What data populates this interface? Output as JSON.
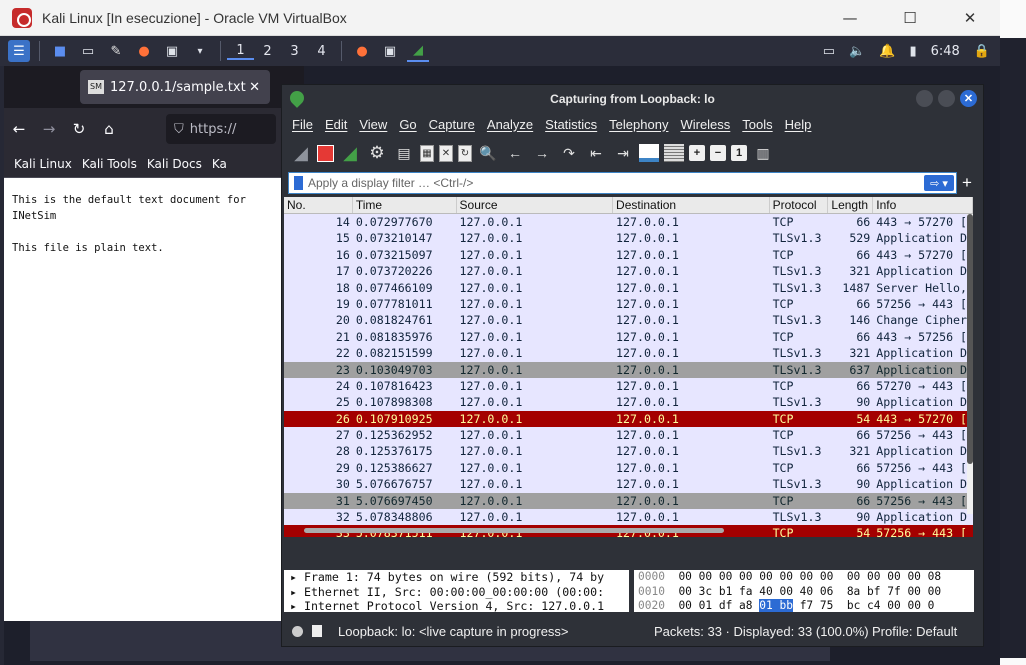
{
  "vbox": {
    "title": "Kali Linux [In esecuzione] - Oracle VM VirtualBox",
    "min": "—",
    "max": "☐",
    "close": "✕"
  },
  "panel": {
    "workspaces": [
      "1",
      "2",
      "3",
      "4"
    ],
    "clock": "6:48"
  },
  "firefox": {
    "tab_title": "127.0.0.1/sample.txt",
    "url": "https://",
    "bookmarks": [
      "Kali Linux",
      "Kali Tools",
      "Kali Docs",
      "Ka"
    ],
    "content_lines": [
      "This is the default text document for INetSim",
      "This file is plain text."
    ]
  },
  "wireshark": {
    "title": "Capturing from Loopback: lo",
    "menu": [
      "File",
      "Edit",
      "View",
      "Go",
      "Capture",
      "Analyze",
      "Statistics",
      "Telephony",
      "Wireless",
      "Tools",
      "Help"
    ],
    "filter_placeholder": "Apply a display filter … <Ctrl-/>",
    "columns": [
      "No.",
      "Time",
      "Source",
      "Destination",
      "Protocol",
      "Length",
      "Info"
    ],
    "packets": [
      {
        "no": "14",
        "time": "0.072977670",
        "src": "127.0.0.1",
        "dst": "127.0.0.1",
        "proto": "TCP",
        "len": "66",
        "info": "443 → 57270 [",
        "style": "tcp"
      },
      {
        "no": "15",
        "time": "0.073210147",
        "src": "127.0.0.1",
        "dst": "127.0.0.1",
        "proto": "TLSv1.3",
        "len": "529",
        "info": "Application D",
        "style": "tls"
      },
      {
        "no": "16",
        "time": "0.073215097",
        "src": "127.0.0.1",
        "dst": "127.0.0.1",
        "proto": "TCP",
        "len": "66",
        "info": "443 → 57270 [",
        "style": "tcp"
      },
      {
        "no": "17",
        "time": "0.073720226",
        "src": "127.0.0.1",
        "dst": "127.0.0.1",
        "proto": "TLSv1.3",
        "len": "321",
        "info": "Application D",
        "style": "tls"
      },
      {
        "no": "18",
        "time": "0.077466109",
        "src": "127.0.0.1",
        "dst": "127.0.0.1",
        "proto": "TLSv1.3",
        "len": "1487",
        "info": "Server Hello,",
        "style": "tls"
      },
      {
        "no": "19",
        "time": "0.077781011",
        "src": "127.0.0.1",
        "dst": "127.0.0.1",
        "proto": "TCP",
        "len": "66",
        "info": "57256 → 443 [",
        "style": "tcp"
      },
      {
        "no": "20",
        "time": "0.081824761",
        "src": "127.0.0.1",
        "dst": "127.0.0.1",
        "proto": "TLSv1.3",
        "len": "146",
        "info": "Change Cipher",
        "style": "tls"
      },
      {
        "no": "21",
        "time": "0.081835976",
        "src": "127.0.0.1",
        "dst": "127.0.0.1",
        "proto": "TCP",
        "len": "66",
        "info": "443 → 57256 [",
        "style": "tcp"
      },
      {
        "no": "22",
        "time": "0.082151599",
        "src": "127.0.0.1",
        "dst": "127.0.0.1",
        "proto": "TLSv1.3",
        "len": "321",
        "info": "Application D",
        "style": "tls"
      },
      {
        "no": "23",
        "time": "0.103049703",
        "src": "127.0.0.1",
        "dst": "127.0.0.1",
        "proto": "TLSv1.3",
        "len": "637",
        "info": "Application D",
        "style": "gray"
      },
      {
        "no": "24",
        "time": "0.107816423",
        "src": "127.0.0.1",
        "dst": "127.0.0.1",
        "proto": "TCP",
        "len": "66",
        "info": "57270 → 443 [",
        "style": "tcp"
      },
      {
        "no": "25",
        "time": "0.107898308",
        "src": "127.0.0.1",
        "dst": "127.0.0.1",
        "proto": "TLSv1.3",
        "len": "90",
        "info": "Application D",
        "style": "tls"
      },
      {
        "no": "26",
        "time": "0.107910925",
        "src": "127.0.0.1",
        "dst": "127.0.0.1",
        "proto": "TCP",
        "len": "54",
        "info": "443 → 57270 [",
        "style": "red"
      },
      {
        "no": "27",
        "time": "0.125362952",
        "src": "127.0.0.1",
        "dst": "127.0.0.1",
        "proto": "TCP",
        "len": "66",
        "info": "57256 → 443 [",
        "style": "tcp"
      },
      {
        "no": "28",
        "time": "0.125376175",
        "src": "127.0.0.1",
        "dst": "127.0.0.1",
        "proto": "TLSv1.3",
        "len": "321",
        "info": "Application D",
        "style": "tls"
      },
      {
        "no": "29",
        "time": "0.125386627",
        "src": "127.0.0.1",
        "dst": "127.0.0.1",
        "proto": "TCP",
        "len": "66",
        "info": "57256 → 443 [",
        "style": "tcp"
      },
      {
        "no": "30",
        "time": "5.076676757",
        "src": "127.0.0.1",
        "dst": "127.0.0.1",
        "proto": "TLSv1.3",
        "len": "90",
        "info": "Application D",
        "style": "tls"
      },
      {
        "no": "31",
        "time": "5.076697450",
        "src": "127.0.0.1",
        "dst": "127.0.0.1",
        "proto": "TCP",
        "len": "66",
        "info": "57256 → 443 [",
        "style": "gray"
      },
      {
        "no": "32",
        "time": "5.078348806",
        "src": "127.0.0.1",
        "dst": "127.0.0.1",
        "proto": "TLSv1.3",
        "len": "90",
        "info": "Application D",
        "style": "tls"
      },
      {
        "no": "33",
        "time": "5.078371511",
        "src": "127.0.0.1",
        "dst": "127.0.0.1",
        "proto": "TCP",
        "len": "54",
        "info": "57256 → 443 [",
        "style": "red"
      }
    ],
    "details": [
      "Frame 1: 74 bytes on wire (592 bits), 74 by",
      "Ethernet II, Src: 00:00:00_00:00:00 (00:00:",
      "Internet Protocol Version 4, Src: 127.0.0.1"
    ],
    "hex": [
      {
        "off": "0000",
        "pre": "00 00 00 00 00 00 00 00  00 00 00 00 08",
        "hl": "",
        "post": ""
      },
      {
        "off": "0010",
        "pre": "00 3c b1 fa 40 00 40 06  8a bf 7f 00 00",
        "hl": "",
        "post": ""
      },
      {
        "off": "0020",
        "pre": "00 01 df a8 ",
        "hl": "01 bb",
        "post": " f7 75  bc c4 00 00 0"
      }
    ],
    "status": {
      "capture": "Loopback: lo: <live capture in progress>",
      "packets": "Packets: 33 · Displayed: 33 (100.0%)",
      "profile": "Profile: Default"
    }
  }
}
